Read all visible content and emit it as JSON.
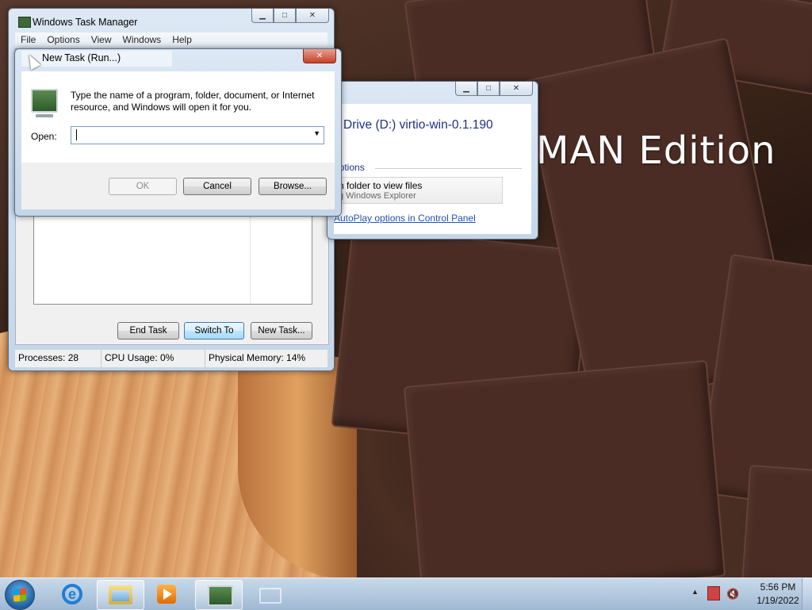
{
  "desktop": {
    "edition_text": "MAN Edition"
  },
  "task_manager": {
    "title": "Windows Task Manager",
    "menu": [
      "File",
      "Options",
      "View",
      "Windows",
      "Help"
    ],
    "buttons": {
      "end_task": "End Task",
      "switch_to": "Switch To",
      "new_task": "New Task..."
    },
    "status": {
      "processes": "Processes: 28",
      "cpu": "CPU Usage: 0%",
      "memory": "Physical Memory: 14%"
    }
  },
  "autoplay": {
    "drive_title": "Drive (D:) virtio-win-0.1.190",
    "section": "options",
    "option_line1": "n folder to view files",
    "option_line2": "g Windows Explorer",
    "link": "AutoPlay options in Control Panel"
  },
  "run_dialog": {
    "title": "New Task (Run...)",
    "description": "Type the name of a program, folder, document, or Internet resource, and Windows will open it for you.",
    "open_label": "Open:",
    "open_value": "",
    "buttons": {
      "ok": "OK",
      "cancel": "Cancel",
      "browse": "Browse..."
    }
  },
  "taskbar": {
    "pinned": [
      "internet-explorer",
      "windows-explorer",
      "media-player",
      "task-manager",
      "blank-window"
    ],
    "tray": {
      "time": "5:56 PM",
      "date": "1/19/2022"
    }
  }
}
